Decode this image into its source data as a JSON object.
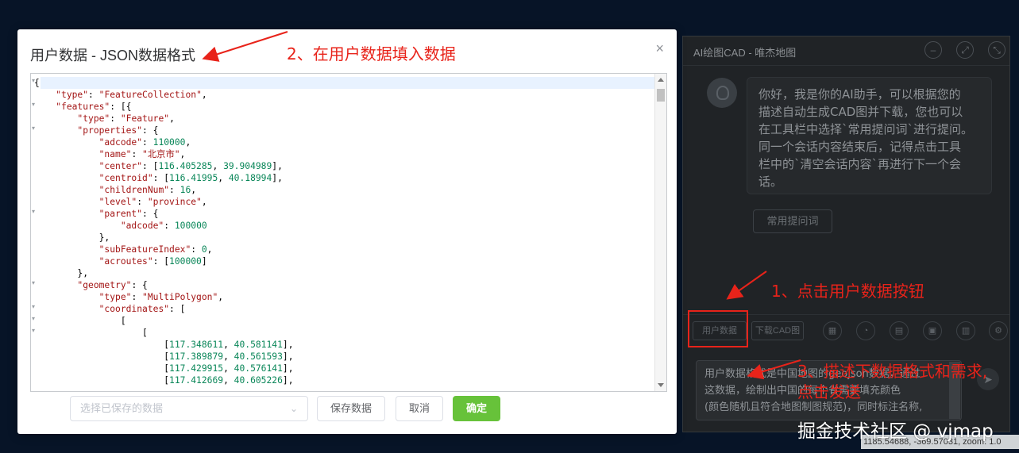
{
  "chat": {
    "title": "AI绘图CAD - 唯杰地图",
    "header_buttons": [
      "–",
      "⤢",
      "⤡"
    ],
    "message_lines": [
      "你好，我是你的AI助手，可以根据您的",
      "描述自动生成CAD图并下载，您也可以",
      "在工具栏中选择`常用提问词`进行提问。",
      "同一个会话内容结束后，记得点击工具",
      "栏中的`清空会话内容`再进行下一个会",
      "话。"
    ],
    "common_prompts_label": "常用提问词",
    "user_data_button": "用户数据",
    "download_cad_button": "下载CAD图",
    "input_lines": [
      "用户数据格式是中国地图的geojson数据，通过",
      "这数据，绘制出中国的每个省需要填充颜色",
      "(颜色随机且符合地图制图规范)，同时标注名称,"
    ],
    "coords_text": "1185.54688, -369.57031, zoom: 1.0",
    "watermark": "掘金技术社区 @ vjmap"
  },
  "modal": {
    "title": "用户数据 - JSON数据格式",
    "close_icon": "×",
    "select_placeholder": "选择已保存的数据",
    "save_button": "保存数据",
    "cancel_button": "取消",
    "confirm_button": "确定",
    "code_lines": [
      "{",
      "    \"type\": \"FeatureCollection\",",
      "    \"features\": [{",
      "        \"type\": \"Feature\",",
      "        \"properties\": {",
      "            \"adcode\": 110000,",
      "            \"name\": \"北京市\",",
      "            \"center\": [116.405285, 39.904989],",
      "            \"centroid\": [116.41995, 40.18994],",
      "            \"childrenNum\": 16,",
      "            \"level\": \"province\",",
      "            \"parent\": {",
      "                \"adcode\": 100000",
      "            },",
      "            \"subFeatureIndex\": 0,",
      "            \"acroutes\": [100000]",
      "        },",
      "        \"geometry\": {",
      "            \"type\": \"MultiPolygon\",",
      "            \"coordinates\": [",
      "                [",
      "                    [",
      "                        [117.348611, 40.581141],",
      "                        [117.389879, 40.561593],",
      "                        [117.429915, 40.576141],",
      "                        [117.412669, 40.605226],"
    ]
  },
  "annotations": {
    "step1": "1、点击用户数据按钮",
    "step2": "2、在用户数据填入数据",
    "step3_line1": "3、描述下数据格式和需求,",
    "step3_line2": "点击发送",
    "color": "#e8231a"
  }
}
